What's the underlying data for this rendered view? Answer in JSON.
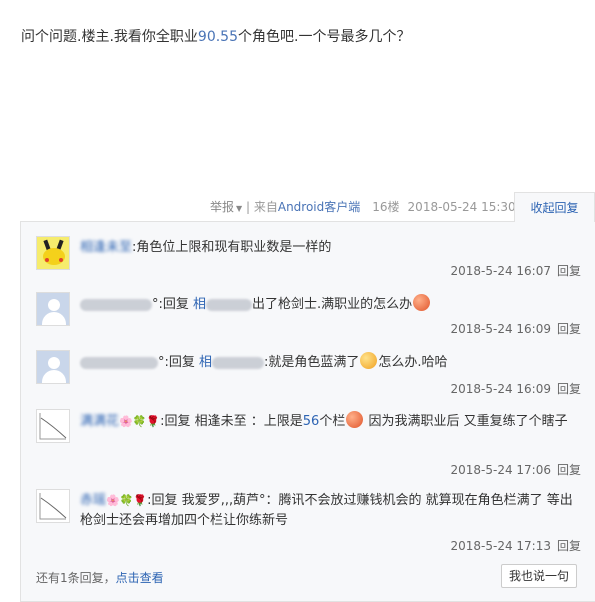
{
  "post": {
    "text_before": "问个问题.楼主.我看你全职业",
    "text_highlight": "90.55",
    "text_after": "个角色吧.一个号最多几个？"
  },
  "meta": {
    "report": "举报",
    "separator": " | 来自",
    "source": "Android客户端",
    "floor": "16楼",
    "date": "2018-05-24 15:30"
  },
  "collapse_label": "收起回复",
  "comments": [
    {
      "avatar": "pikachu-avatar",
      "user": "相逢未至",
      "text": ":角色位上限和现有职业数是一样的",
      "time": "2018-5-24 16:07",
      "reply": "回复"
    },
    {
      "avatar": "default-avatar",
      "user_suffix": "°",
      "text_a": ":回复 ",
      "reply_target": "相",
      "text_b": "出了枪剑士.满职业的怎么办",
      "time": "2018-5-24 16:09",
      "reply": "回复"
    },
    {
      "avatar": "default-avatar",
      "user_suffix": "°",
      "text_a": ":回复 ",
      "reply_target": "相",
      "text_b": ":就是角色蓝满了",
      "text_c": "怎么办.哈哈",
      "time": "2018-5-24 16:09",
      "reply": "回复"
    },
    {
      "avatar": "sketch-avatar",
      "user": "满满花",
      "text_a": ":回复 相逢未至 ：上限是",
      "number": "56",
      "text_b": "个栏",
      "text_c": " 因为我满职业后 又重复练了个瞎子",
      "time": "2018-5-24 17:06",
      "reply": "回复"
    },
    {
      "avatar": "sketch-avatar",
      "user": "赤瑶",
      "text": ":回复 我爱罗‚‚‚葫芦°：腾讯不会放过赚钱机会的 就算现在角色栏满了 等出枪剑士还会再增加四个栏让你练新号",
      "time": "2018-5-24 17:13",
      "reply": "回复"
    }
  ],
  "footer": {
    "more_before": "还有",
    "more_count": "1",
    "more_after": "条回复，",
    "view_label": "点击查看",
    "say_button": "我也说一句"
  }
}
